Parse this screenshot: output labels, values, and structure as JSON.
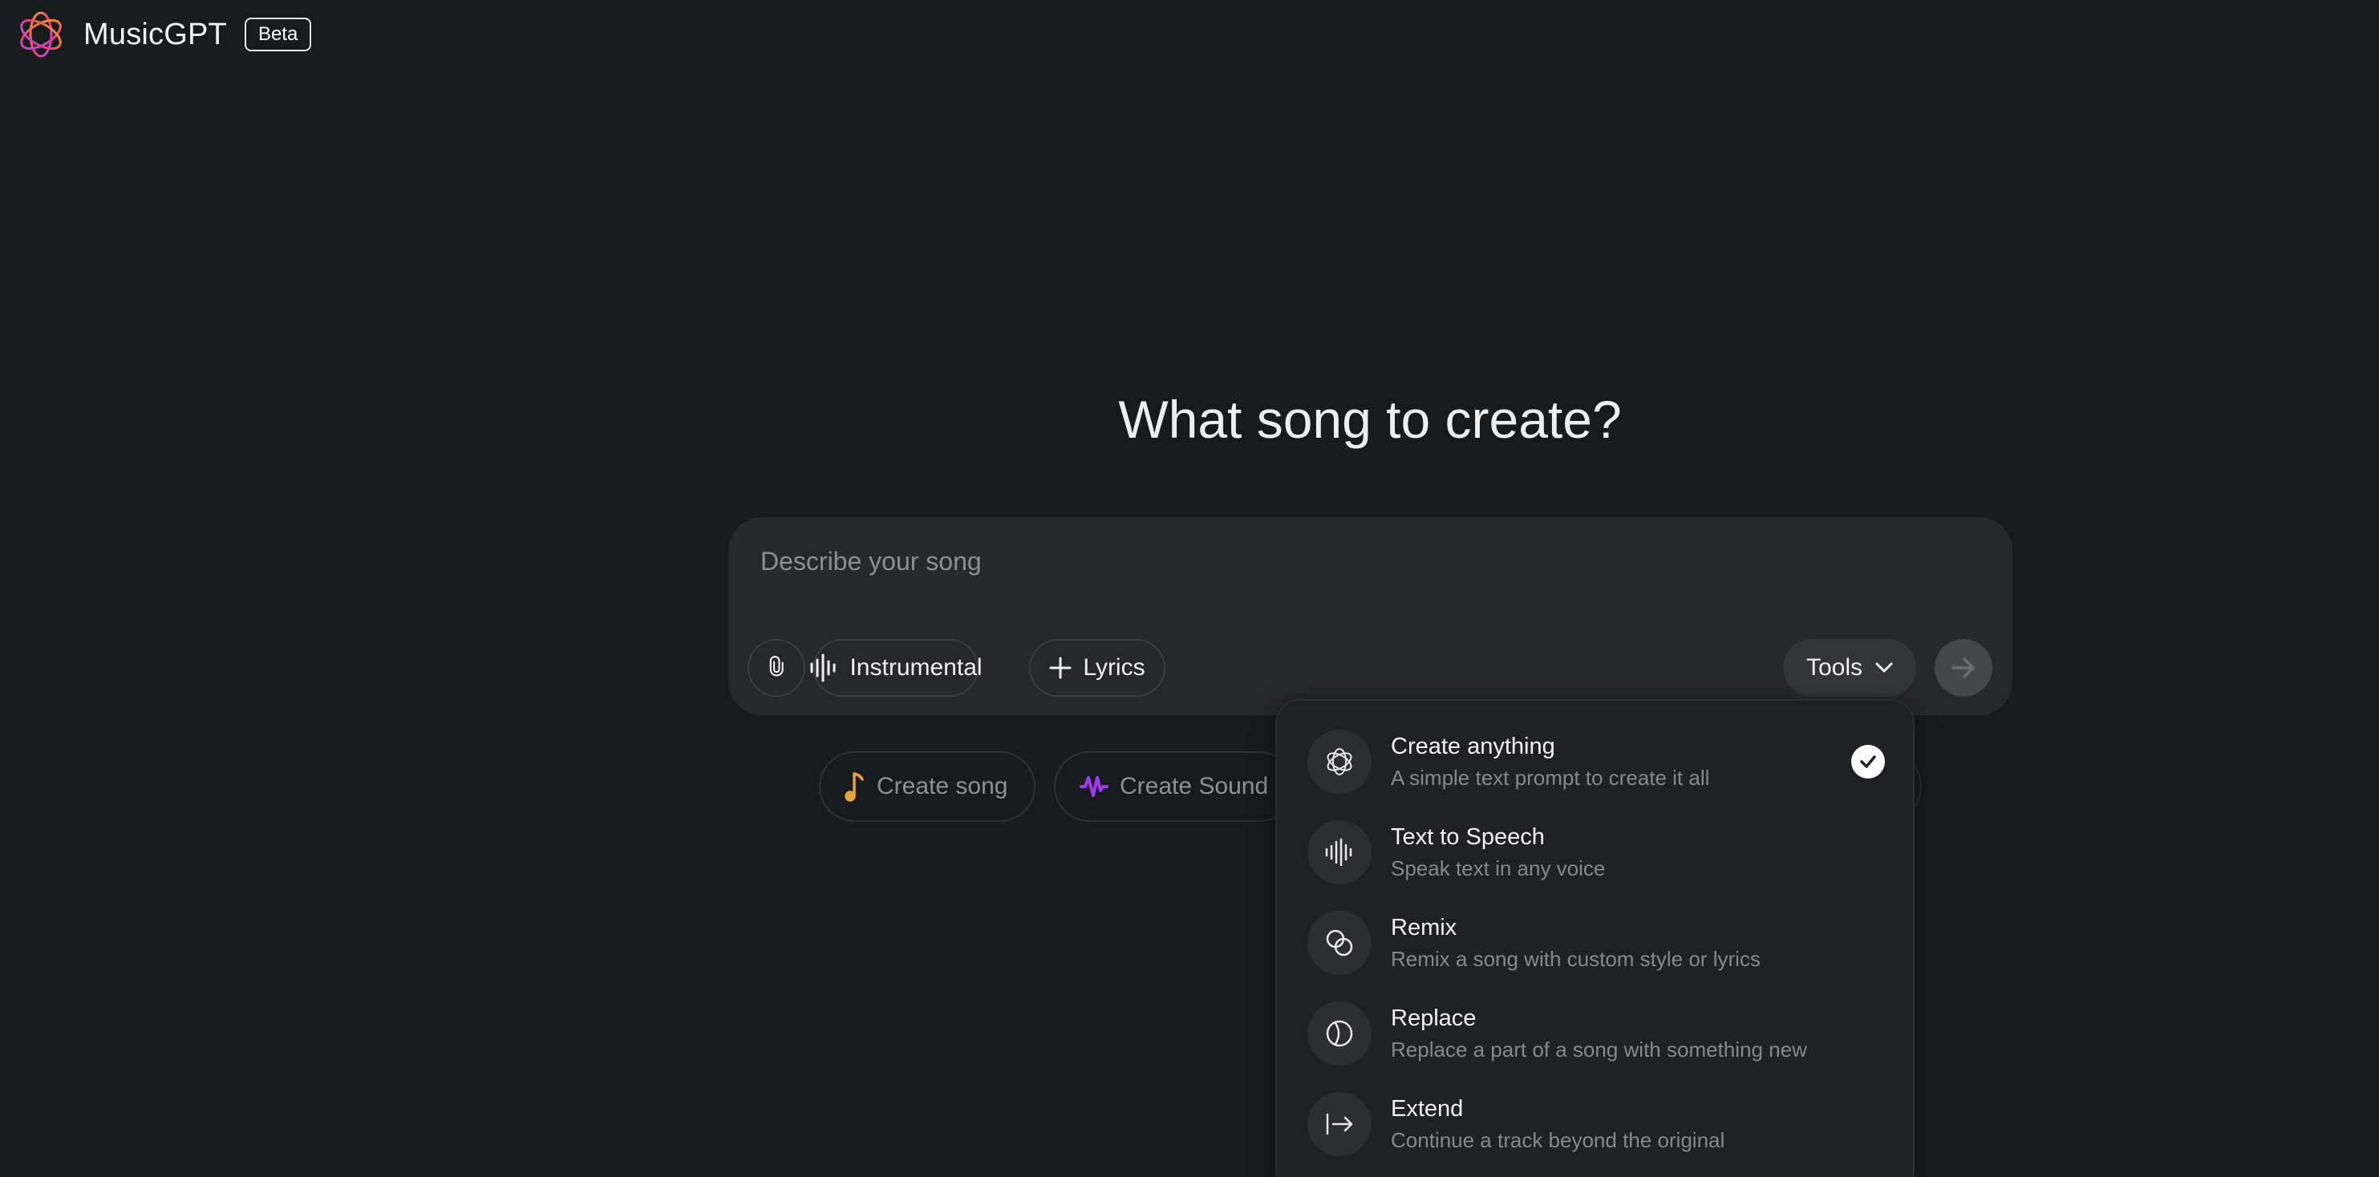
{
  "header": {
    "brand": "MusicGPT",
    "badge": "Beta"
  },
  "main": {
    "heading": "What song to create?"
  },
  "composer": {
    "placeholder": "Describe your song",
    "value": "",
    "instrumental_label": "Instrumental",
    "lyrics_label": "Lyrics",
    "tools_label": "Tools"
  },
  "chips": [
    {
      "label": "Create song",
      "icon": "music-note-icon",
      "color": "#e8a33a"
    },
    {
      "label": "Create Sound",
      "icon": "waveform-icon",
      "color": "#a23bf0"
    }
  ],
  "tools_menu": {
    "items": [
      {
        "title": "Create anything",
        "desc": "A simple text prompt to create it all",
        "icon": "logo-outline-icon",
        "selected": true
      },
      {
        "title": "Text to Speech",
        "desc": "Speak text in any voice",
        "icon": "waveform-icon",
        "selected": false
      },
      {
        "title": "Remix",
        "desc": "Remix a song with custom style or lyrics",
        "icon": "overlapping-circles-icon",
        "selected": false
      },
      {
        "title": "Replace",
        "desc": "Replace a part of a song with something new",
        "icon": "replace-circle-icon",
        "selected": false
      },
      {
        "title": "Extend",
        "desc": "Continue a track beyond the original",
        "icon": "extend-arrow-icon",
        "selected": false
      }
    ]
  },
  "colors": {
    "background": "#181b1e",
    "composer": "#27282c",
    "logo_gradient": [
      "#f7a21b",
      "#e9407a",
      "#b24bf3"
    ]
  }
}
